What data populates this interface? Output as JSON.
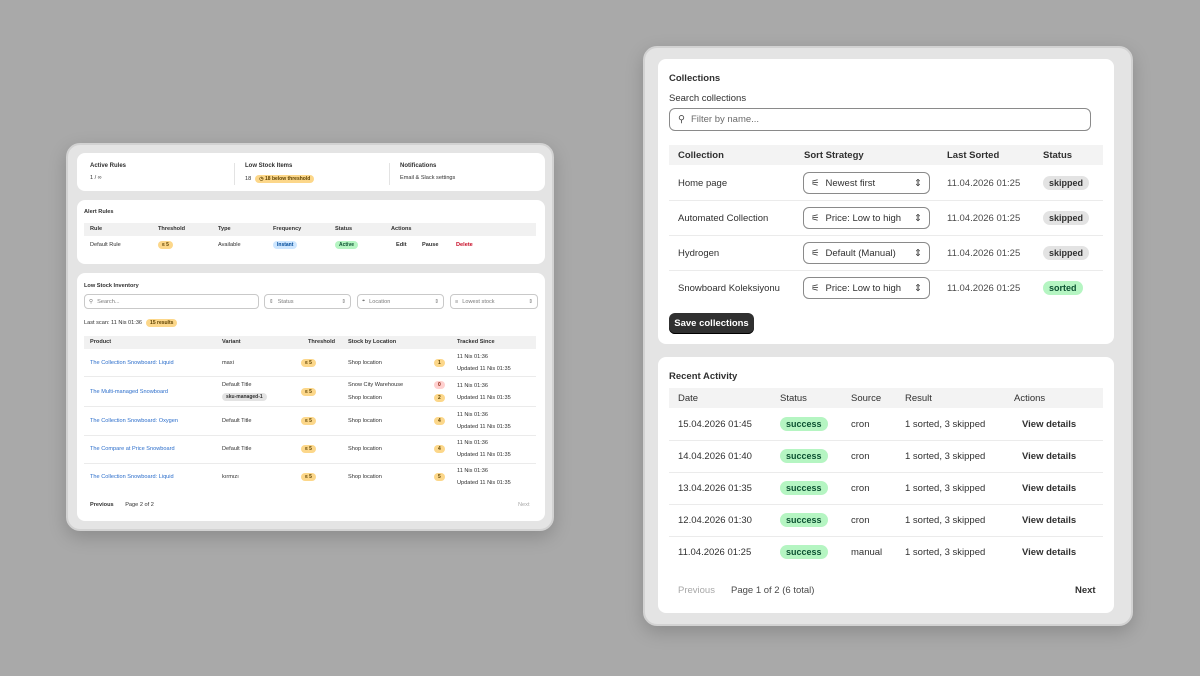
{
  "left": {
    "stats": [
      {
        "label": "Active Rules",
        "value": "1 / ∞"
      },
      {
        "label": "Low Stock Items",
        "value": "18",
        "badge": "18 below threshold"
      },
      {
        "label": "Notifications",
        "value": "Email & Slack settings"
      }
    ],
    "alert_rules": {
      "title": "Alert Rules",
      "headers": [
        "Rule",
        "Threshold",
        "Type",
        "Frequency",
        "Status",
        "Actions"
      ],
      "row": {
        "rule": "Default Rule",
        "threshold": "≤ 5",
        "type": "Available",
        "frequency": "Instant",
        "status": "Active",
        "edit": "Edit",
        "pause": "Pause",
        "delete": "Delete"
      }
    },
    "inventory": {
      "title": "Low Stock Inventory",
      "search_placeholder": "Search...",
      "status_filter": "Status",
      "location_filter": "Location",
      "sort": "Lowest stock",
      "last_scan": "Last scan: 11 Nis 01:36",
      "results_badge": "15 results",
      "headers": [
        "Product",
        "Variant",
        "Threshold",
        "Stock by Location",
        "Tracked Since"
      ],
      "rows": [
        {
          "product": "The Collection Snowboard: Liquid",
          "variant": "maxi",
          "threshold": "≤ 5",
          "locations": [
            {
              "name": "Shop location",
              "qty": "1",
              "tone": "amber"
            }
          ],
          "since": "11 Nis 01:36",
          "updated": "Updated 11 Nis 01:35"
        },
        {
          "product": "The Multi-managed Snowboard",
          "variant": "Default Title",
          "sku": "sku-managed-1",
          "threshold": "≤ 5",
          "locations": [
            {
              "name": "Snow City Warehouse",
              "qty": "0",
              "tone": "red"
            },
            {
              "name": "Shop location",
              "qty": "2",
              "tone": "amber"
            }
          ],
          "since": "11 Nis 01:36",
          "updated": "Updated 11 Nis 01:35"
        },
        {
          "product": "The Collection Snowboard: Oxygen",
          "variant": "Default Title",
          "threshold": "≤ 5",
          "locations": [
            {
              "name": "Shop location",
              "qty": "4",
              "tone": "amber"
            }
          ],
          "since": "11 Nis 01:36",
          "updated": "Updated 11 Nis 01:35"
        },
        {
          "product": "The Compare at Price Snowboard",
          "variant": "Default Title",
          "threshold": "≤ 5",
          "locations": [
            {
              "name": "Shop location",
              "qty": "4",
              "tone": "amber"
            }
          ],
          "since": "11 Nis 01:36",
          "updated": "Updated 11 Nis 01:35"
        },
        {
          "product": "The Collection Snowboard: Liquid",
          "variant": "kırmızı",
          "threshold": "≤ 5",
          "locations": [
            {
              "name": "Shop location",
              "qty": "5",
              "tone": "amber"
            }
          ],
          "since": "11 Nis 01:36",
          "updated": "Updated 11 Nis 01:35"
        }
      ],
      "pagination": {
        "previous": "Previous",
        "page": "Page 2 of 2",
        "next": "Next"
      }
    }
  },
  "right": {
    "collections": {
      "title": "Collections",
      "search_label": "Search collections",
      "search_placeholder": "Filter by name...",
      "headers": [
        "Collection",
        "Sort Strategy",
        "Last Sorted",
        "Status"
      ],
      "rows": [
        {
          "name": "Home page",
          "strategy": "Newest first",
          "last_sorted": "11.04.2026 01:25",
          "status": "skipped"
        },
        {
          "name": "Automated Collection",
          "strategy": "Price: Low to high",
          "last_sorted": "11.04.2026 01:25",
          "status": "skipped"
        },
        {
          "name": "Hydrogen",
          "strategy": "Default (Manual)",
          "last_sorted": "11.04.2026 01:25",
          "status": "skipped"
        },
        {
          "name": "Snowboard Koleksiyonu",
          "strategy": "Price: Low to high",
          "last_sorted": "11.04.2026 01:25",
          "status": "sorted"
        }
      ],
      "save_label": "Save collections"
    },
    "activity": {
      "title": "Recent Activity",
      "headers": [
        "Date",
        "Status",
        "Source",
        "Result",
        "Actions"
      ],
      "rows": [
        {
          "date": "15.04.2026 01:45",
          "status": "success",
          "source": "cron",
          "result": "1 sorted, 3 skipped",
          "action": "View details"
        },
        {
          "date": "14.04.2026 01:40",
          "status": "success",
          "source": "cron",
          "result": "1 sorted, 3 skipped",
          "action": "View details"
        },
        {
          "date": "13.04.2026 01:35",
          "status": "success",
          "source": "cron",
          "result": "1 sorted, 3 skipped",
          "action": "View details"
        },
        {
          "date": "12.04.2026 01:30",
          "status": "success",
          "source": "cron",
          "result": "1 sorted, 3 skipped",
          "action": "View details"
        },
        {
          "date": "11.04.2026 01:25",
          "status": "success",
          "source": "manual",
          "result": "1 sorted, 3 skipped",
          "action": "View details"
        }
      ],
      "pagination": {
        "previous": "Previous",
        "page": "Page 1 of 2 (6 total)",
        "next": "Next"
      }
    }
  },
  "colors": {
    "background": "#a9a9a9",
    "success": "#b5f5c2",
    "skipped": "#e3e3e3",
    "amber": "#fcd78a",
    "primary_button": "#303030",
    "link": "#2c6ecb"
  },
  "icons": [
    "search-icon",
    "sort-arrows-icon",
    "location-pin-icon",
    "filter-lines-icon",
    "sliders-icon",
    "chevron-updown-icon"
  ]
}
